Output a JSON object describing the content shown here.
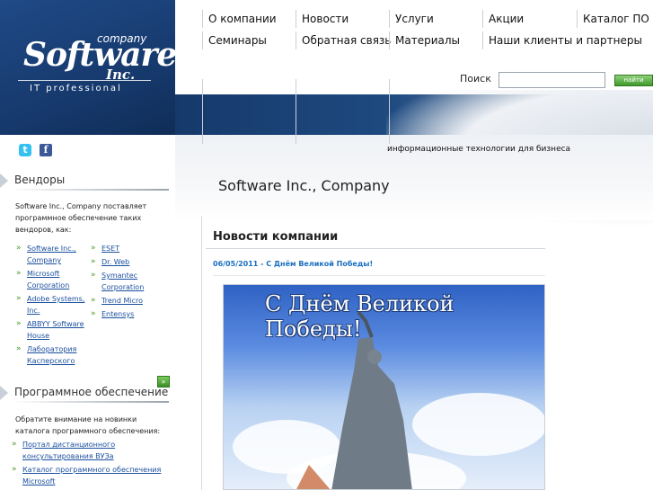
{
  "logo": {
    "company": "company",
    "software": "Software",
    "inc": "Inc.",
    "tagline": "IT professional"
  },
  "nav": {
    "row1": [
      "О компании",
      "Новости",
      "Услуги",
      "Акции",
      "Каталог ПО"
    ],
    "row2": [
      "Семинары",
      "Обратная связь",
      "Материалы",
      "Наши клиенты и партнеры"
    ]
  },
  "search": {
    "label": "Поиск",
    "value": "",
    "button": "найти"
  },
  "banner": {
    "tagline": "информационные технологии для бизнеса",
    "company_title": "Software Inc., Company"
  },
  "sidebar": {
    "social": {
      "twitter": "t",
      "facebook": "f"
    },
    "vendors": {
      "title": "Вендоры",
      "intro": "Software Inc., Company поставляет программное обеспечение таких вендоров, как:",
      "col1": [
        "Software Inc., Company",
        "Microsoft Corporation",
        "Adobe Systems, Inc.",
        "ABBYY Software House",
        "Лаборатория Касперского"
      ],
      "col2": [
        "ESET",
        "Dr. Web",
        "Symantec Corporation",
        "Trend Micro",
        "Entensys"
      ]
    },
    "more_button": "»",
    "software": {
      "title": "Программное обеспечение",
      "intro": "Обратите внимание на новинки каталога программного обеспечения:",
      "links": [
        "Портал дистанционного консультирования ВУЗа",
        "Каталог программного обеспечения Microsoft"
      ]
    }
  },
  "main": {
    "section_title": "Новости компании",
    "news": [
      {
        "date_title": "06/05/2011 - С Днём Великой Победы!",
        "image_caption": "С Днём Великой Победы!"
      }
    ]
  },
  "colors": {
    "header_blue": "#173a6e",
    "link_blue": "#1a4f9e",
    "news_link": "#1a6fc0",
    "bullet_green": "#4a9a2a",
    "button_green": "#3f9a2b"
  }
}
